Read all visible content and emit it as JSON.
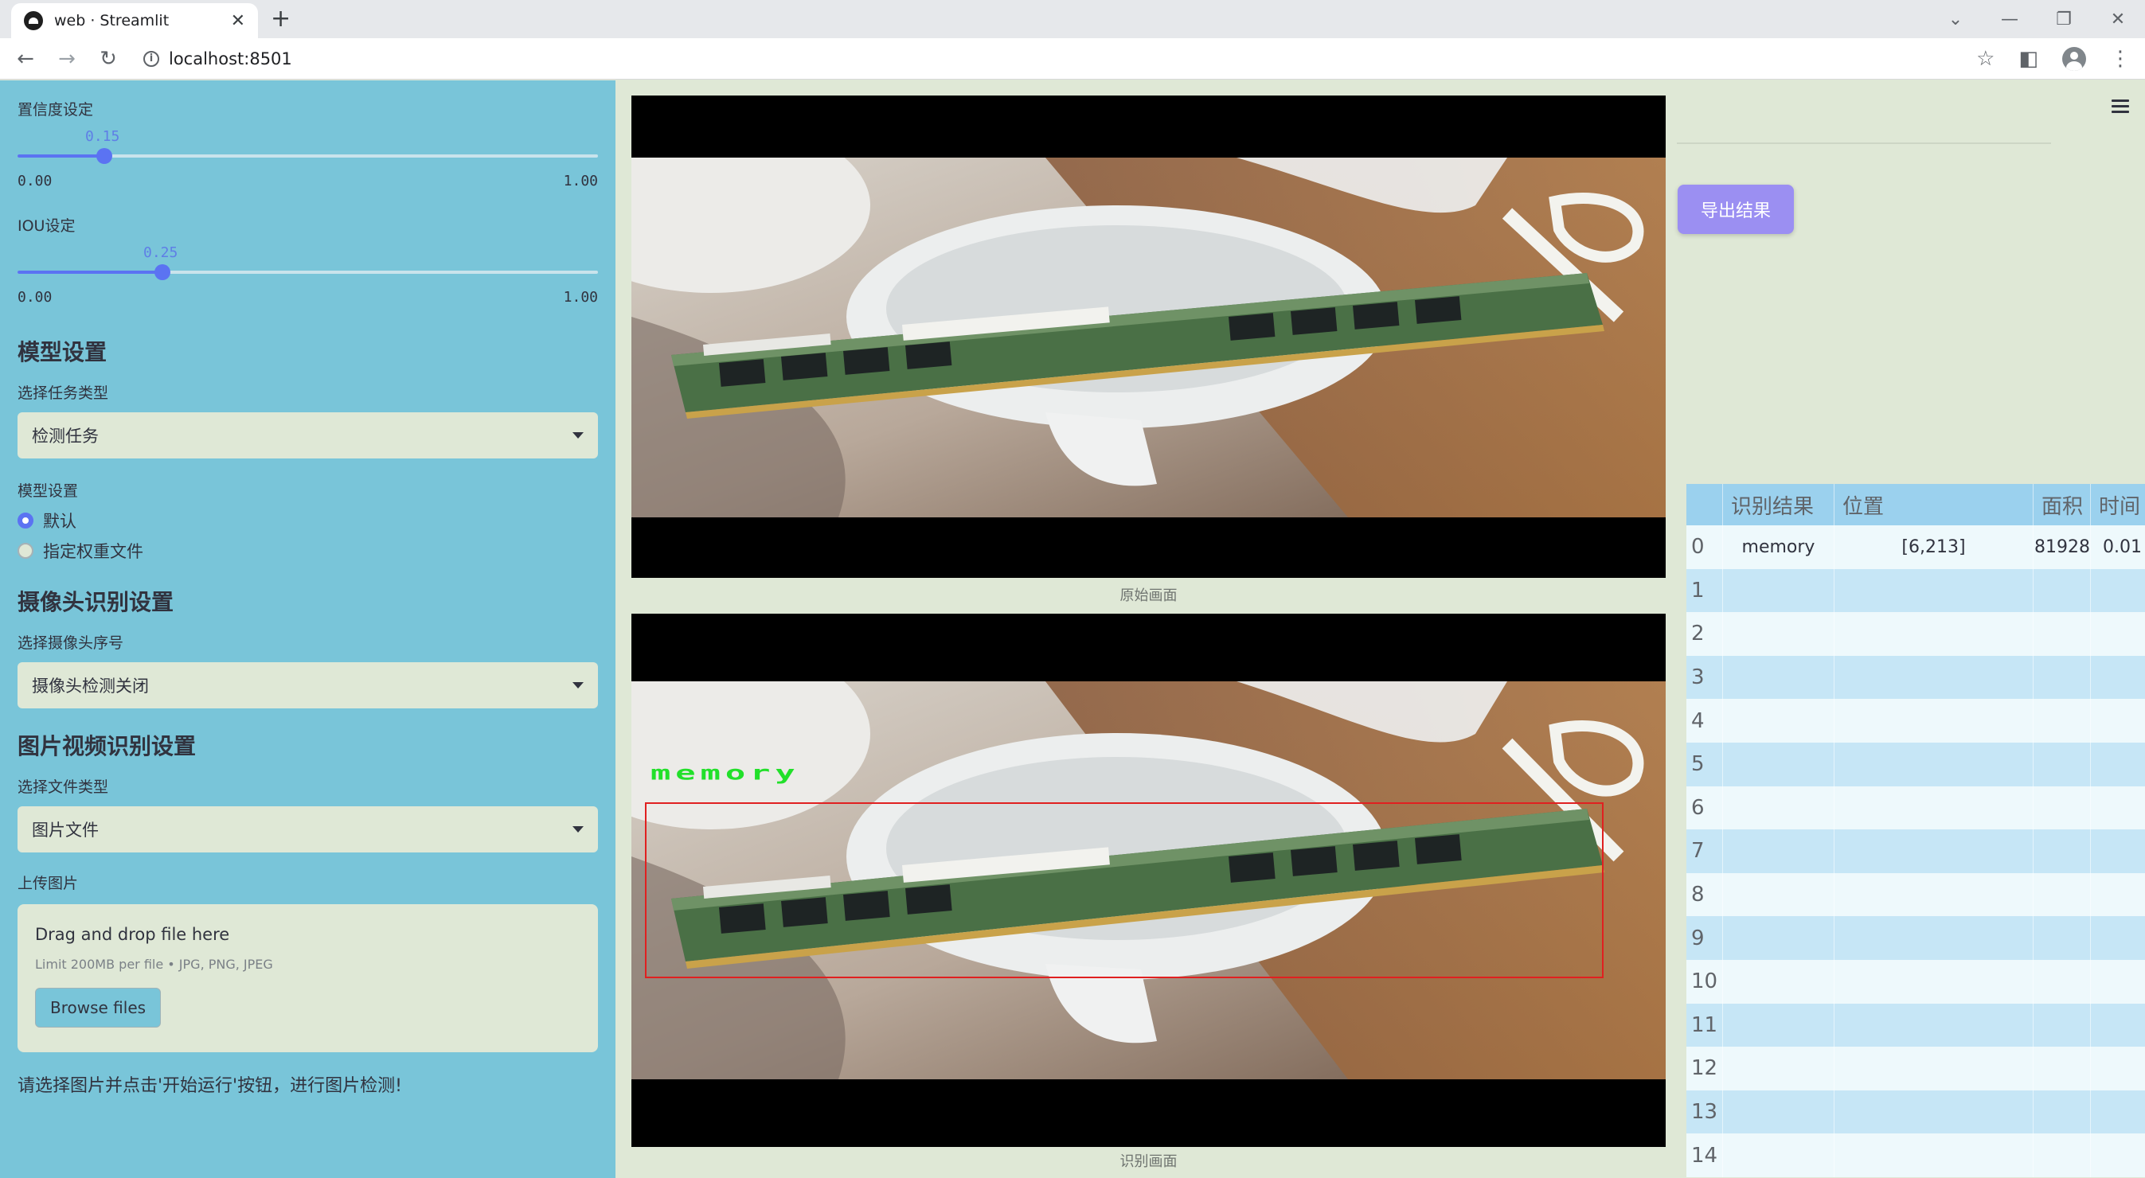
{
  "browser": {
    "tab_title": "web · Streamlit",
    "new_tab": "+",
    "url": "localhost:8501"
  },
  "sidebar": {
    "confidence": {
      "label": "置信度设定",
      "value": "0.15",
      "min": "0.00",
      "max": "1.00",
      "level": 0.15
    },
    "iou": {
      "label": "IOU设定",
      "value": "0.25",
      "min": "0.00",
      "max": "1.00",
      "level": 0.25
    },
    "model_section": "模型设置",
    "task_label": "选择任务类型",
    "task_value": "检测任务",
    "model_label": "模型设置",
    "model_options": [
      "默认",
      "指定权重文件"
    ],
    "model_selected": 0,
    "camera_section": "摄像头识别设置",
    "camera_label": "选择摄像头序号",
    "camera_value": "摄像头检测关闭",
    "media_section": "图片视频识别设置",
    "filetype_label": "选择文件类型",
    "filetype_value": "图片文件",
    "upload_label": "上传图片",
    "upload_title": "Drag and drop file here",
    "upload_limit": "Limit 200MB per file • JPG, PNG, JPEG",
    "browse_button": "Browse files",
    "hint": "请选择图片并点击'开始运行'按钮，进行图片检测!"
  },
  "main": {
    "original_caption": "原始画面",
    "result_caption": "识别画面",
    "detection_label": "memory",
    "export_button": "导出结果",
    "table": {
      "headers": [
        "",
        "识别结果",
        "位置",
        "面积",
        "时间"
      ],
      "rows": [
        [
          "0",
          "memory",
          "[6,213]",
          "81928",
          "0.01"
        ],
        [
          "1",
          "",
          "",
          "",
          ""
        ],
        [
          "2",
          "",
          "",
          "",
          ""
        ],
        [
          "3",
          "",
          "",
          "",
          ""
        ],
        [
          "4",
          "",
          "",
          "",
          ""
        ],
        [
          "5",
          "",
          "",
          "",
          ""
        ],
        [
          "6",
          "",
          "",
          "",
          ""
        ],
        [
          "7",
          "",
          "",
          "",
          ""
        ],
        [
          "8",
          "",
          "",
          "",
          ""
        ],
        [
          "9",
          "",
          "",
          "",
          ""
        ],
        [
          "10",
          "",
          "",
          "",
          ""
        ],
        [
          "11",
          "",
          "",
          "",
          ""
        ],
        [
          "12",
          "",
          "",
          "",
          ""
        ],
        [
          "13",
          "",
          "",
          "",
          ""
        ],
        [
          "14",
          "",
          "",
          "",
          ""
        ]
      ]
    }
  },
  "colors": {
    "sidebar_bg": "#79c5d9",
    "main_bg": "#dfe8d6",
    "accent": "#5b73f2",
    "export_btn": "#9b8ff2",
    "detect_box": "#e02020",
    "detect_label": "#22e02a"
  }
}
